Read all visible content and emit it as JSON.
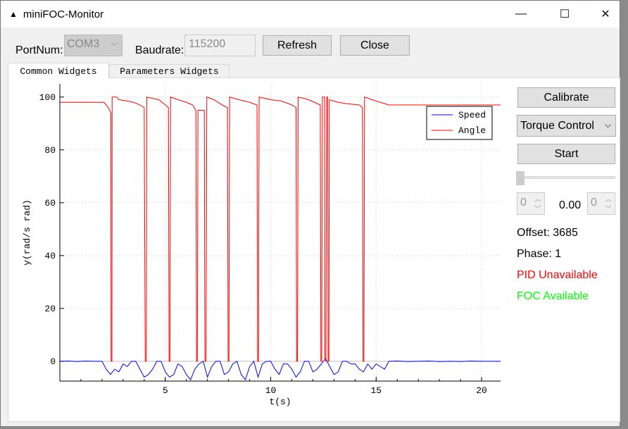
{
  "window": {
    "title": "miniFOC-Monitor",
    "icon": "app-logo-icon",
    "controls": [
      "minimize-icon",
      "maximize-icon",
      "close-icon"
    ]
  },
  "toolbar": {
    "port_label": "PortNum:",
    "port_value": "COM3",
    "baud_label": "Baudrate:",
    "baud_value": "115200",
    "refresh": "Refresh",
    "close": "Close"
  },
  "tabs": [
    {
      "label": "Common Widgets",
      "active": true
    },
    {
      "label": "Parameters Widgets",
      "active": false
    }
  ],
  "side": {
    "calibrate": "Calibrate",
    "mode": "Torque Control",
    "start": "Start",
    "slider_value": 0,
    "spin_left": "0",
    "value": "0.00",
    "spin_right": "0",
    "offset": "Offset: 3685",
    "phase": "Phase: 1",
    "pid": "PID Unavailable",
    "foc": "FOC Available",
    "pid_color": "#ff0000",
    "foc_color": "#00ff00"
  },
  "chart_data": {
    "type": "line",
    "xlabel": "t(s)",
    "ylabel": "y(rad/s rad)",
    "xlim": [
      0,
      20.9
    ],
    "ylim": [
      -7.5,
      105
    ],
    "xticks": [
      5,
      10,
      15,
      20
    ],
    "yticks": [
      0,
      20,
      40,
      60,
      80,
      100
    ],
    "grid": true,
    "legend": "top-right",
    "series": [
      {
        "name": "Speed",
        "color": "#0000ff",
        "points": [
          [
            0,
            0
          ],
          [
            0.4,
            0.1
          ],
          [
            0.8,
            -0.1
          ],
          [
            1.2,
            0.1
          ],
          [
            1.6,
            0
          ],
          [
            2.0,
            0
          ],
          [
            2.2,
            -3
          ],
          [
            2.4,
            -5
          ],
          [
            2.6,
            -3
          ],
          [
            2.8,
            -4
          ],
          [
            3.0,
            -1
          ],
          [
            3.2,
            -2
          ],
          [
            3.4,
            0
          ],
          [
            3.6,
            0
          ],
          [
            3.8,
            -3
          ],
          [
            4.0,
            -6
          ],
          [
            4.2,
            -5
          ],
          [
            4.4,
            -3
          ],
          [
            4.6,
            0
          ],
          [
            4.8,
            0
          ],
          [
            5.0,
            -4
          ],
          [
            5.2,
            -6
          ],
          [
            5.4,
            -5
          ],
          [
            5.6,
            -1
          ],
          [
            5.8,
            -2
          ],
          [
            6.0,
            -5
          ],
          [
            6.2,
            -7
          ],
          [
            6.4,
            -3
          ],
          [
            6.6,
            -1
          ],
          [
            6.8,
            0
          ],
          [
            7.0,
            -6
          ],
          [
            7.2,
            -2
          ],
          [
            7.4,
            0
          ],
          [
            7.6,
            0
          ],
          [
            7.8,
            -5
          ],
          [
            8.0,
            -4
          ],
          [
            8.2,
            -1
          ],
          [
            8.4,
            0
          ],
          [
            8.6,
            -5
          ],
          [
            8.8,
            -7
          ],
          [
            9.0,
            -2
          ],
          [
            9.2,
            0
          ],
          [
            9.4,
            -6
          ],
          [
            9.6,
            -1
          ],
          [
            9.8,
            0
          ],
          [
            10.0,
            0
          ],
          [
            10.2,
            -3
          ],
          [
            10.4,
            -5
          ],
          [
            10.6,
            -1
          ],
          [
            10.8,
            -1
          ],
          [
            11.0,
            -3
          ],
          [
            11.2,
            -6
          ],
          [
            11.4,
            -4
          ],
          [
            11.6,
            0
          ],
          [
            11.8,
            0
          ],
          [
            12.0,
            -4
          ],
          [
            12.2,
            -3
          ],
          [
            12.4,
            -1
          ],
          [
            12.6,
            1
          ],
          [
            12.8,
            -2
          ],
          [
            13.0,
            -5
          ],
          [
            13.2,
            -4
          ],
          [
            13.4,
            0
          ],
          [
            13.6,
            0
          ],
          [
            13.8,
            -1
          ],
          [
            14.0,
            -1
          ],
          [
            14.2,
            -3
          ],
          [
            14.4,
            -4
          ],
          [
            14.6,
            -1
          ],
          [
            14.8,
            -3
          ],
          [
            15.0,
            -1
          ],
          [
            15.2,
            -2
          ],
          [
            15.4,
            -3
          ],
          [
            15.6,
            0
          ],
          [
            16.0,
            0.1
          ],
          [
            16.5,
            -0.1
          ],
          [
            17,
            0
          ],
          [
            17.5,
            0.1
          ],
          [
            18,
            -0.1
          ],
          [
            18.5,
            0
          ],
          [
            19,
            -0.1
          ],
          [
            19.5,
            0.1
          ],
          [
            20,
            0
          ],
          [
            20.9,
            0
          ]
        ]
      },
      {
        "name": "Angle",
        "color": "#ff0000",
        "points": [
          [
            0,
            98
          ],
          [
            2.1,
            98
          ],
          [
            2.3,
            96
          ],
          [
            2.42,
            94
          ],
          [
            2.43,
            0
          ],
          [
            2.47,
            0
          ],
          [
            2.48,
            100
          ],
          [
            2.7,
            100
          ],
          [
            2.8,
            99
          ],
          [
            3.2,
            98.5
          ],
          [
            3.5,
            98
          ],
          [
            3.8,
            97
          ],
          [
            4.0,
            96
          ],
          [
            4.05,
            0
          ],
          [
            4.1,
            0
          ],
          [
            4.12,
            100
          ],
          [
            4.4,
            99.5
          ],
          [
            4.7,
            99
          ],
          [
            5.0,
            97
          ],
          [
            5.15,
            96
          ],
          [
            5.18,
            0
          ],
          [
            5.22,
            0
          ],
          [
            5.25,
            100
          ],
          [
            5.6,
            99
          ],
          [
            6.0,
            98
          ],
          [
            6.3,
            97
          ],
          [
            6.45,
            95
          ],
          [
            6.48,
            0
          ],
          [
            6.52,
            0
          ],
          [
            6.55,
            95
          ],
          [
            6.85,
            95
          ],
          [
            6.88,
            0
          ],
          [
            6.93,
            0
          ],
          [
            6.97,
            100
          ],
          [
            7.3,
            99
          ],
          [
            7.7,
            97
          ],
          [
            7.95,
            96
          ],
          [
            7.98,
            0
          ],
          [
            8.02,
            0
          ],
          [
            8.05,
            100
          ],
          [
            8.5,
            99
          ],
          [
            9.0,
            98
          ],
          [
            9.35,
            97
          ],
          [
            9.38,
            0
          ],
          [
            9.42,
            0
          ],
          [
            9.45,
            100
          ],
          [
            10,
            99
          ],
          [
            10.5,
            98.5
          ],
          [
            11.0,
            97
          ],
          [
            11.2,
            96
          ],
          [
            11.23,
            0
          ],
          [
            11.27,
            0
          ],
          [
            11.3,
            100
          ],
          [
            11.8,
            99
          ],
          [
            12.35,
            97
          ],
          [
            12.38,
            0
          ],
          [
            12.42,
            0
          ],
          [
            12.45,
            100
          ],
          [
            12.55,
            100
          ],
          [
            12.57,
            1
          ],
          [
            12.62,
            0
          ],
          [
            12.65,
            100
          ],
          [
            12.7,
            100
          ],
          [
            12.72,
            0
          ],
          [
            12.76,
            0
          ],
          [
            12.78,
            99
          ],
          [
            13.2,
            98
          ],
          [
            13.6,
            97.5
          ],
          [
            14.2,
            97
          ],
          [
            14.35,
            96
          ],
          [
            14.38,
            0
          ],
          [
            14.42,
            0
          ],
          [
            14.45,
            100
          ],
          [
            14.8,
            99
          ],
          [
            15.2,
            98
          ],
          [
            15.6,
            97
          ],
          [
            20.9,
            97
          ]
        ]
      }
    ]
  }
}
